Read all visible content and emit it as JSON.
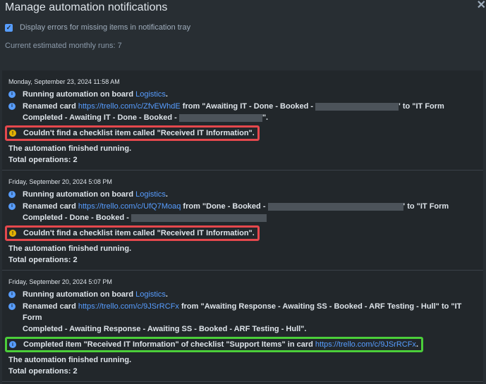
{
  "dialog": {
    "title": "Manage automation notifications",
    "close_glyph": "✕",
    "option_label": "Display errors for missing items in notification tray",
    "option_checked": true,
    "runs_text": "Current estimated monthly runs: 7"
  },
  "entries": [
    {
      "date": "Monday, September 23, 2024 11:58 AM",
      "running_prefix": "Running automation on board ",
      "board": "Logistics",
      "renamed_prefix": "Renamed card ",
      "link": "https://trello.com/c/ZfvEWhdE",
      "from_text": " from \"Awaiting IT - Done - Booked - ",
      "to_text": "' to \"IT Form",
      "line2": "Completed - Awaiting IT - Done - Booked -",
      "line2_end": "\".",
      "warning": "Couldn't find a checklist item called \"Received IT Information\".",
      "finished": "The automation finished running.",
      "total": "Total operations: 2"
    },
    {
      "date": "Friday, September 20, 2024 5:08 PM",
      "running_prefix": "Running automation on board ",
      "board": "Logistics",
      "renamed_prefix": "Renamed card ",
      "link": "https://trello.com/c/UfQ7Moaq",
      "from_text": " from \"Done - Booked - ",
      "to_text": "' to \"IT Form",
      "line2": "Completed - Done - Booked -",
      "warning": "Couldn't find a checklist item called \"Received IT Information\".",
      "finished": "The automation finished running.",
      "total": "Total operations: 2"
    },
    {
      "date": "Friday, September 20, 2024 5:07 PM",
      "running_prefix": "Running automation on board ",
      "board": "Logistics",
      "renamed_prefix": "Renamed card ",
      "link": "https://trello.com/c/9JSrRCFx",
      "from_text": " from \"Awaiting Response - Awaiting SS - Booked - ARF Testing - Hull\" to \"IT Form",
      "line2": "Completed - Awaiting Response - Awaiting SS - Booked - ARF Testing - Hull\".",
      "completed_text": "Completed item \"Received IT Information\" of checklist \"Support Items\" in card ",
      "completed_link": "https://trello.com/c/9JSrRCFx",
      "completed_end": ".",
      "finished": "The automation finished running.",
      "total": "Total operations: 2"
    }
  ],
  "icons": {
    "info": "i",
    "warn": "!",
    "check": "✓"
  },
  "colors": {
    "link": "#579dff",
    "error_highlight": "#e5484d",
    "success_highlight": "#4bce3a",
    "warning_icon": "#e2b203"
  }
}
